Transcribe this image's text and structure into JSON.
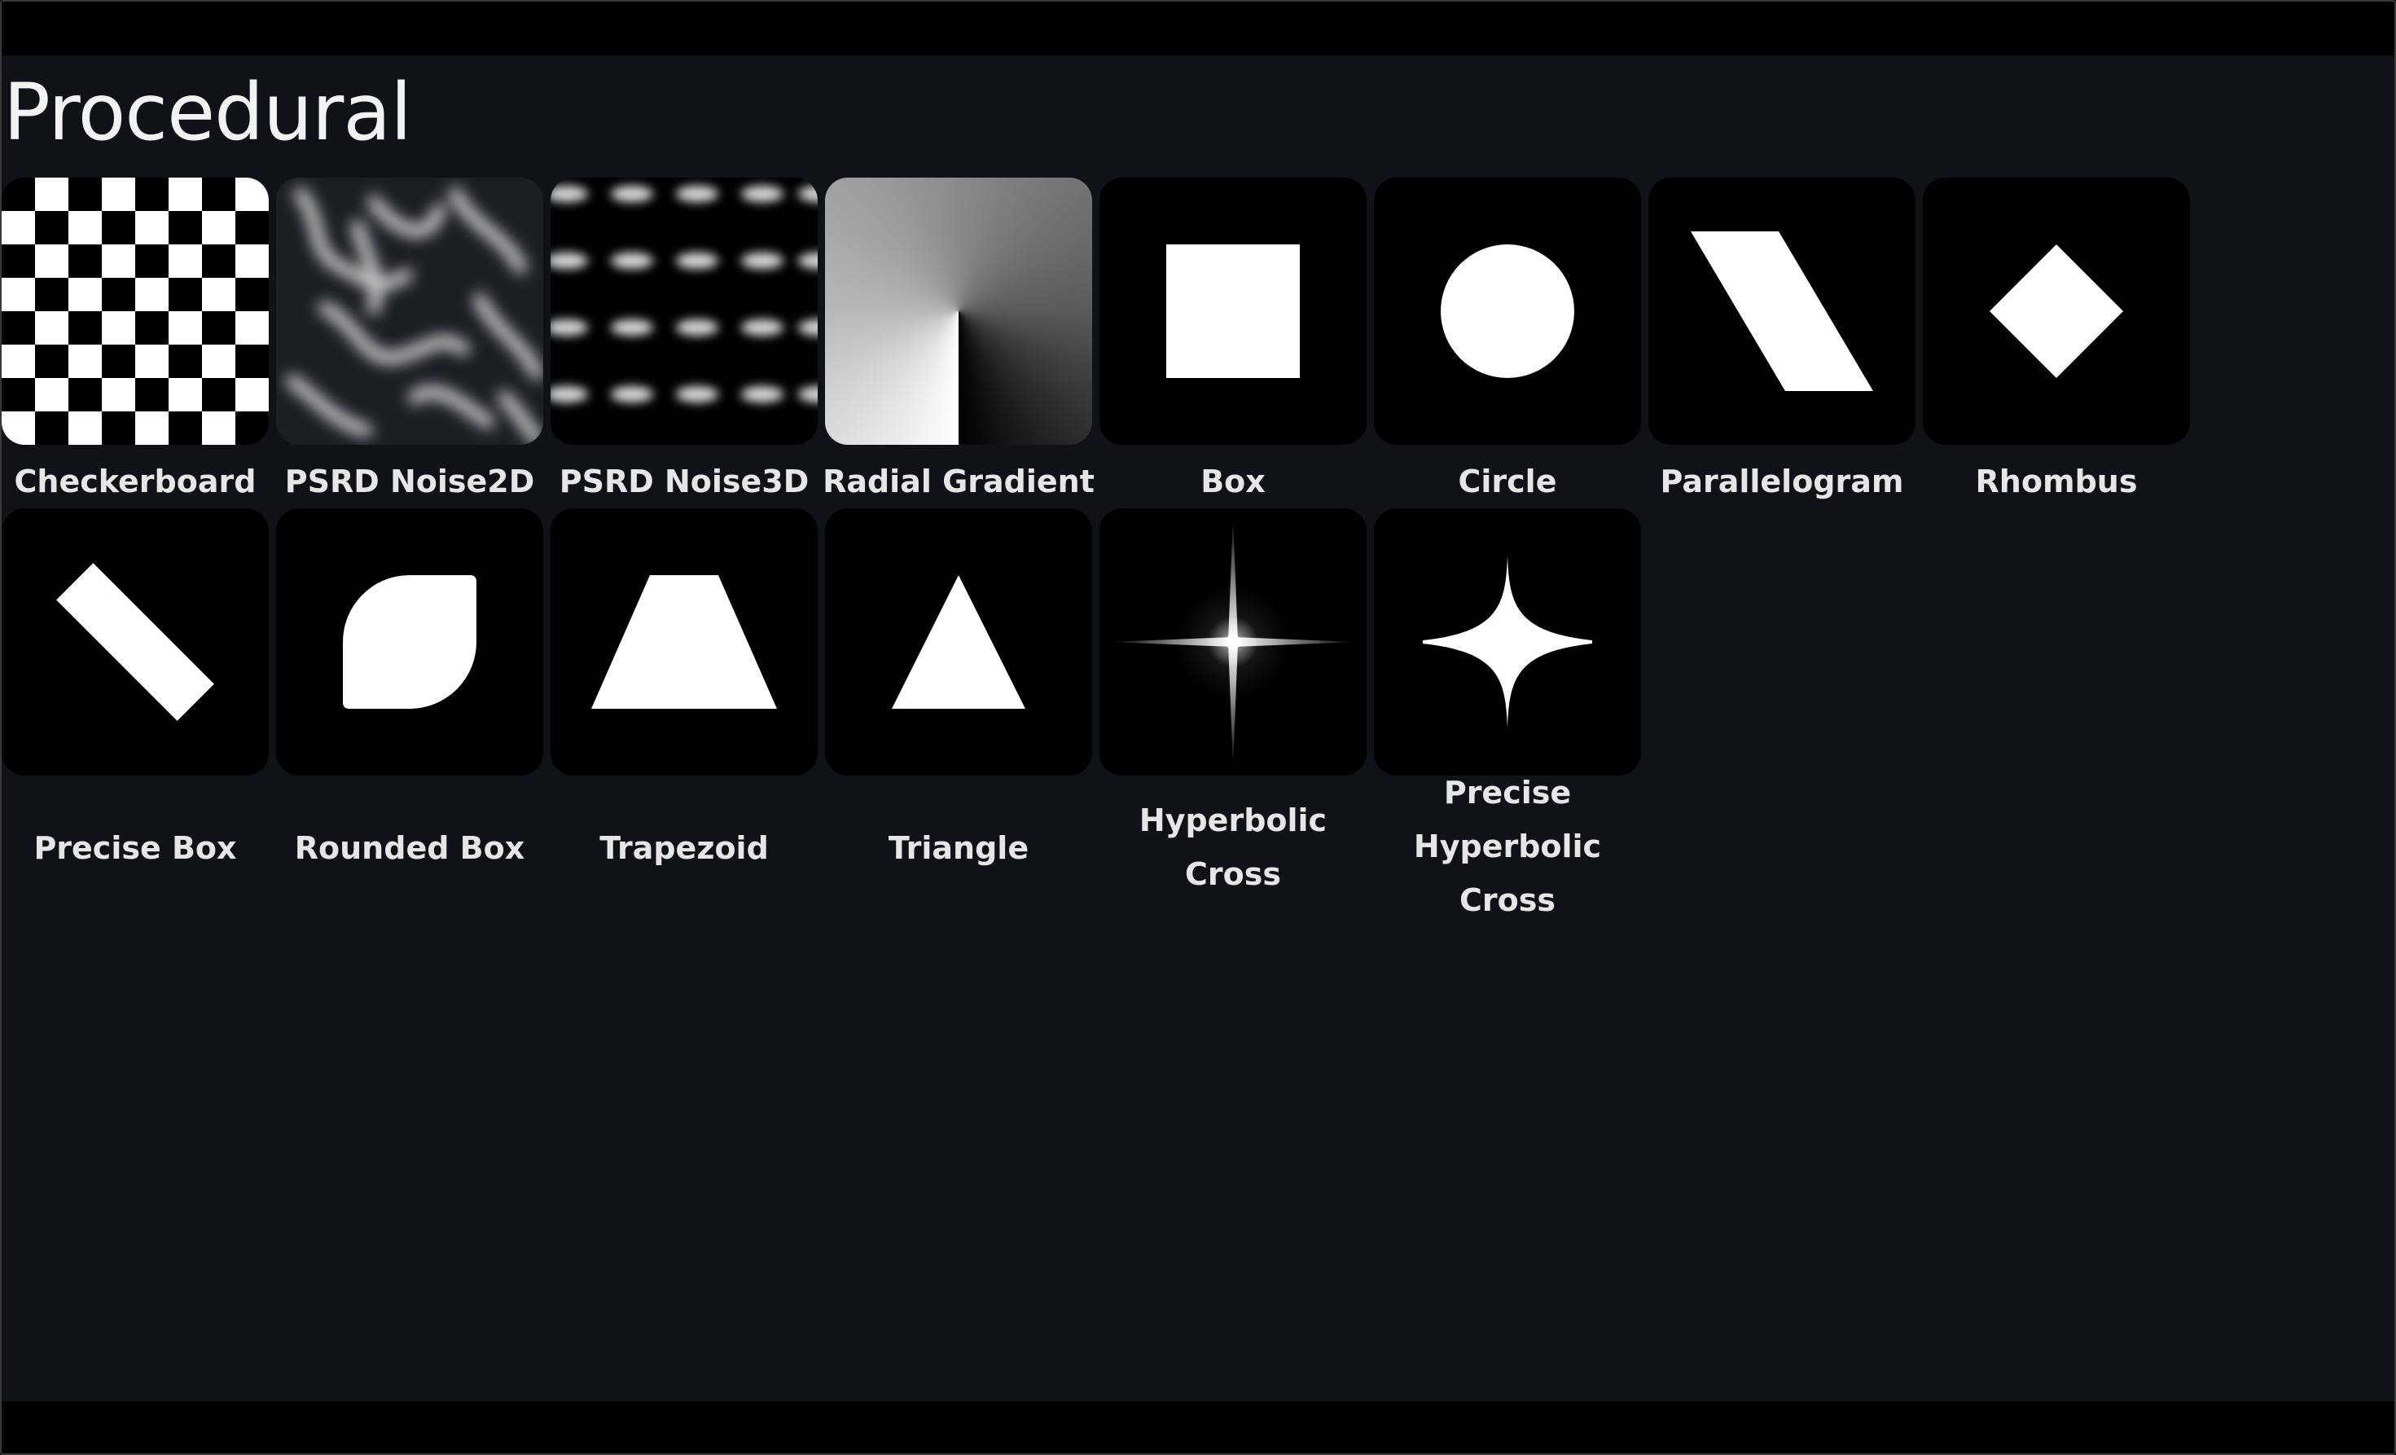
{
  "section": {
    "title": "Procedural"
  },
  "items": [
    {
      "label": "Checkerboard",
      "icon": "checkerboard-pattern-icon"
    },
    {
      "label": "PSRD Noise2D",
      "icon": "noise-2d-icon"
    },
    {
      "label": "PSRD Noise3D",
      "icon": "noise-3d-icon"
    },
    {
      "label": "Radial Gradient",
      "icon": "radial-gradient-icon"
    },
    {
      "label": "Box",
      "icon": "box-shape-icon"
    },
    {
      "label": "Circle",
      "icon": "circle-shape-icon"
    },
    {
      "label": "Parallelogram",
      "icon": "parallelogram-shape-icon"
    },
    {
      "label": "Rhombus",
      "icon": "rhombus-shape-icon"
    },
    {
      "label": "Precise Box",
      "icon": "precise-box-shape-icon"
    },
    {
      "label": "Rounded Box",
      "icon": "rounded-box-shape-icon"
    },
    {
      "label": "Trapezoid",
      "icon": "trapezoid-shape-icon"
    },
    {
      "label": "Triangle",
      "icon": "triangle-shape-icon"
    },
    {
      "label": "Hyperbolic Cross",
      "icon": "hyperbolic-cross-icon"
    },
    {
      "label": "Precise Hyperbolic Cross",
      "icon": "precise-hyperbolic-cross-icon"
    }
  ],
  "colors": {
    "background": "#0f1216",
    "thumbnail": "#000000",
    "text": "#e6e6e6"
  }
}
